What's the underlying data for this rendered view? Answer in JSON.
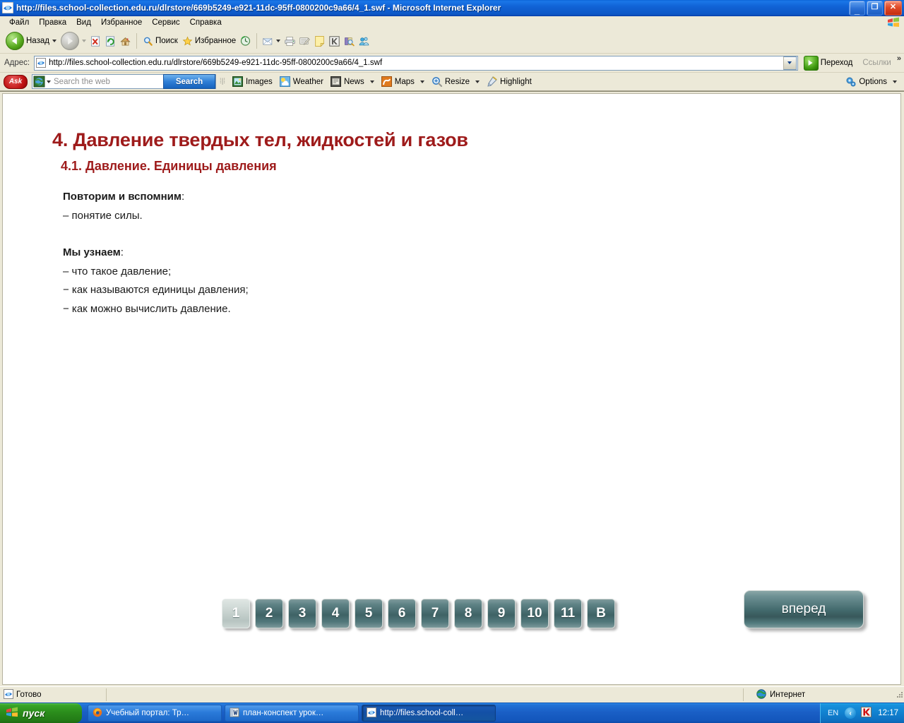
{
  "window": {
    "title": "http://files.school-collection.edu.ru/dlrstore/669b5249-e921-11dc-95ff-0800200c9a66/4_1.swf - Microsoft Internet Explorer",
    "icon": "ie-document-icon",
    "minimize_label": "_",
    "restore_label": "❐",
    "close_label": "✕"
  },
  "menubar": {
    "items": [
      {
        "label": "Файл",
        "name": "menu-file"
      },
      {
        "label": "Правка",
        "name": "menu-edit"
      },
      {
        "label": "Вид",
        "name": "menu-view"
      },
      {
        "label": "Избранное",
        "name": "menu-favorites"
      },
      {
        "label": "Сервис",
        "name": "menu-tools"
      },
      {
        "label": "Справка",
        "name": "menu-help"
      }
    ]
  },
  "toolbar": {
    "back_label": "Назад",
    "forward_label": "",
    "search_label": "Поиск",
    "favorites_label": "Избранное",
    "buttons": [
      {
        "name": "stop-button",
        "label": ""
      },
      {
        "name": "refresh-button",
        "label": ""
      },
      {
        "name": "home-button",
        "label": ""
      },
      {
        "name": "history-button",
        "label": ""
      },
      {
        "name": "mail-button",
        "label": ""
      },
      {
        "name": "print-button",
        "label": ""
      },
      {
        "name": "edit-button",
        "label": ""
      },
      {
        "name": "notes-button",
        "label": ""
      },
      {
        "name": "kaspersky-button",
        "label": ""
      },
      {
        "name": "research-button",
        "label": ""
      },
      {
        "name": "messenger-button",
        "label": ""
      }
    ]
  },
  "addressbar": {
    "label": "Адрес:",
    "url": "http://files.school-collection.edu.ru/dlrstore/669b5249-e921-11dc-95ff-0800200c9a66/4_1.swf",
    "go_label": "Переход",
    "links_label": "Ссылки",
    "chevron": "»"
  },
  "asktoolbar": {
    "brand": "Ask",
    "search_placeholder": "Search the web",
    "search_value": "",
    "search_button": "Search",
    "items": [
      {
        "label": "Images",
        "name": "ask-images-button",
        "caret": false
      },
      {
        "label": "Weather",
        "name": "ask-weather-button",
        "caret": false
      },
      {
        "label": "News",
        "name": "ask-news-button",
        "caret": true
      },
      {
        "label": "Maps",
        "name": "ask-maps-button",
        "caret": true
      },
      {
        "label": "Resize",
        "name": "ask-resize-button",
        "caret": true
      },
      {
        "label": "Highlight",
        "name": "ask-highlight-button",
        "caret": false
      }
    ],
    "options_label": "Options"
  },
  "page": {
    "heading": "4. Давление твердых тел, жидкостей и газов",
    "subheading": "4.1. Давление. Единицы давления",
    "heading_color": "#9e1b1b",
    "blocks": [
      {
        "lead": "Повторим и вспомним",
        "colon": ":",
        "lines": [
          "– понятие силы."
        ]
      },
      {
        "lead": "Мы узнаем",
        "colon": ":",
        "lines": [
          "– что такое давление;",
          "− как называются единицы давления;",
          "− как можно вычислить давление."
        ]
      }
    ],
    "nav_buttons": [
      {
        "label": "1",
        "active": true
      },
      {
        "label": "2",
        "active": false
      },
      {
        "label": "3",
        "active": false
      },
      {
        "label": "4",
        "active": false
      },
      {
        "label": "5",
        "active": false
      },
      {
        "label": "6",
        "active": false
      },
      {
        "label": "7",
        "active": false
      },
      {
        "label": "8",
        "active": false
      },
      {
        "label": "9",
        "active": false
      },
      {
        "label": "10",
        "active": false
      },
      {
        "label": "11",
        "active": false
      },
      {
        "label": "В",
        "active": false
      }
    ],
    "forward_button": "вперед"
  },
  "statusbar": {
    "status": "Готово",
    "zone": "Интернет"
  },
  "taskbar": {
    "start_label": "пуск",
    "tasks": [
      {
        "label": "Учебный портал: Тр…",
        "icon": "firefox-icon",
        "active": false
      },
      {
        "label": "план-конспект урок…",
        "icon": "word-icon",
        "active": false
      },
      {
        "label": "http://files.school-coll…",
        "icon": "ie-icon",
        "active": true
      }
    ],
    "language": "EN",
    "clock": "12:17",
    "tray_icons": [
      "show-hidden-icon",
      "kaspersky-icon"
    ]
  }
}
